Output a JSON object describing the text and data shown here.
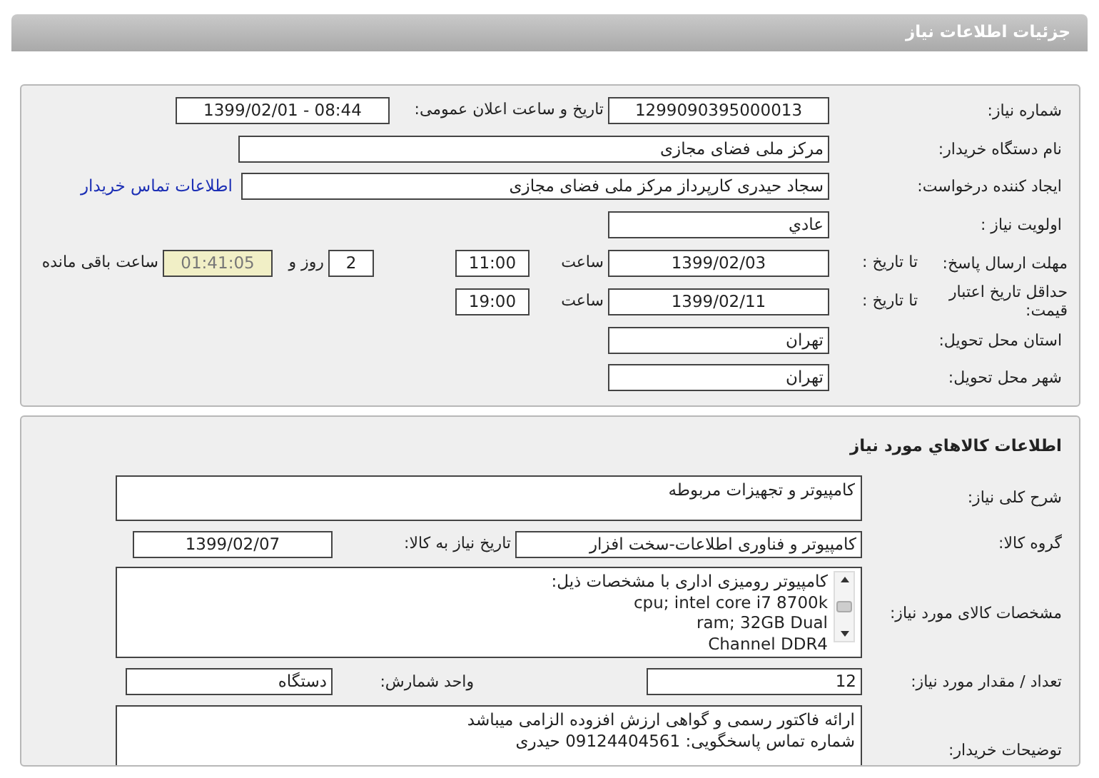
{
  "page_title": "جزئیات اطلاعات نیاز",
  "need_panel": {
    "fields": [
      {
        "label": "شماره نیاز:",
        "parts": [
          {
            "kind": "field",
            "text": "1299090395000013"
          },
          {
            "kind": "text",
            "text": "تاریخ و ساعت اعلان عمومی:"
          },
          {
            "kind": "field",
            "text": "1399/02/01 - 08:44"
          }
        ]
      },
      {
        "label": "نام دستگاه خریدار:",
        "parts": [
          {
            "kind": "field",
            "text": "مرکز ملی فضای مجازی"
          }
        ]
      },
      {
        "label": "ایجاد کننده درخواست:",
        "parts": [
          {
            "kind": "field",
            "text": "سجاد حیدری کارپرداز مرکز ملی فضای مجازی"
          },
          {
            "kind": "link",
            "text": "اطلاعات تماس خریدار"
          }
        ]
      },
      {
        "label": "اولویت نیاز :",
        "parts": [
          {
            "kind": "field",
            "text": "عادي"
          }
        ]
      },
      {
        "label": "مهلت ارسال پاسخ:",
        "sublabel": "تا تاریخ :",
        "parts": [
          {
            "kind": "field",
            "text": "1399/02/03"
          },
          {
            "kind": "text",
            "text": "ساعت"
          },
          {
            "kind": "field",
            "text": "11:00"
          },
          {
            "kind": "field",
            "text": "2"
          },
          {
            "kind": "text",
            "text": "روز و"
          },
          {
            "kind": "timer",
            "text": "01:41:05"
          },
          {
            "kind": "text",
            "text": "ساعت باقی مانده"
          }
        ]
      },
      {
        "label": "حداقل تاریخ اعتبار قیمت:",
        "sublabel": "تا تاریخ :",
        "parts": [
          {
            "kind": "field",
            "text": "1399/02/11"
          },
          {
            "kind": "text",
            "text": "ساعت"
          },
          {
            "kind": "field",
            "text": "19:00"
          }
        ]
      },
      {
        "label": "استان محل تحویل:",
        "parts": [
          {
            "kind": "field",
            "text": "تهران"
          }
        ]
      },
      {
        "label": "شهر محل تحویل:",
        "parts": [
          {
            "kind": "field",
            "text": "تهران"
          }
        ]
      }
    ]
  },
  "goods_panel": {
    "title": "اطلاعات كالاهاي مورد نياز",
    "fields": [
      {
        "label": "شرح کلی نیاز:",
        "parts": [
          {
            "kind": "area",
            "lines": [
              "کامپیوتر و تجهیزات مربوطه"
            ]
          }
        ]
      },
      {
        "label": "گروه کالا:",
        "parts": [
          {
            "kind": "field",
            "text": "کامپیوتر و فناوری اطلاعات-سخت افزار"
          },
          {
            "kind": "text",
            "text": "تاریخ نیاز به کالا:"
          },
          {
            "kind": "field",
            "text": "1399/02/07"
          }
        ]
      },
      {
        "label": "مشخصات کالای مورد نیاز:",
        "parts": [
          {
            "kind": "scroll_area",
            "lines": [
              "کامپیوتر رومیزی اداری با مشخصات ذیل:",
              "cpu; intel core i7 8700k",
              "ram; 32GB Dual",
              "Channel DDR4"
            ]
          }
        ]
      },
      {
        "label": "تعداد / مقدار مورد نیاز:",
        "parts": [
          {
            "kind": "field",
            "text": "12"
          },
          {
            "kind": "text",
            "text": "واحد شمارش:"
          },
          {
            "kind": "field",
            "text": "دستگاه"
          }
        ]
      },
      {
        "label": "توضیحات خریدار:",
        "parts": [
          {
            "kind": "area",
            "lines": [
              "ارائه فاکتور رسمی و گواهی ارزش افزوده الزامی میباشد",
              "شماره تماس پاسخگویی: 09124404561 حیدری"
            ]
          }
        ]
      }
    ]
  }
}
